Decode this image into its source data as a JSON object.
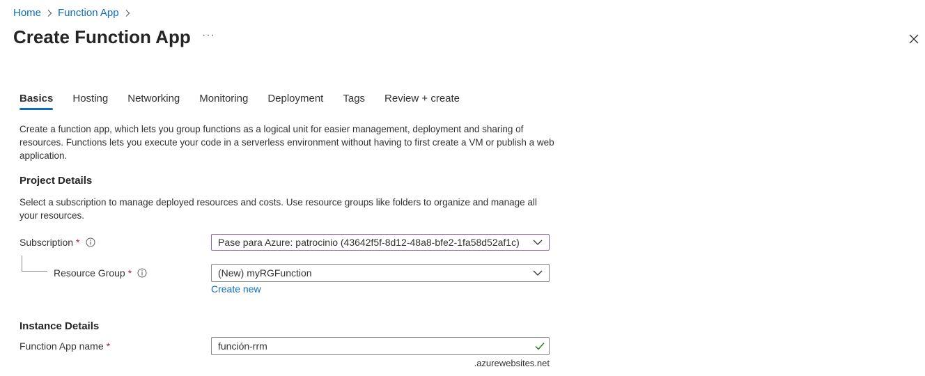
{
  "breadcrumb": {
    "home": "Home",
    "function_app": "Function App"
  },
  "header": {
    "title": "Create Function App",
    "more": "···"
  },
  "tabs": [
    {
      "label": "Basics"
    },
    {
      "label": "Hosting"
    },
    {
      "label": "Networking"
    },
    {
      "label": "Monitoring"
    },
    {
      "label": "Deployment"
    },
    {
      "label": "Tags"
    },
    {
      "label": "Review + create"
    }
  ],
  "intro": "Create a function app, which lets you group functions as a logical unit for easier management, deployment and sharing of resources. Functions lets you execute your code in a serverless environment without having to first create a VM or publish a web application.",
  "project": {
    "heading": "Project Details",
    "desc": "Select a subscription to manage deployed resources and costs. Use resource groups like folders to organize and manage all your resources.",
    "subscription_label": "Subscription",
    "subscription_value": "Pase para Azure: patrocinio (43642f5f-8d12-48a8-bfe2-1fa58d52af1c)",
    "resource_group_label": "Resource Group",
    "resource_group_value": "(New) myRGFunction",
    "create_new": "Create new",
    "required_mark": "*"
  },
  "instance": {
    "heading": "Instance Details",
    "name_label": "Function App name",
    "name_value": "función-rrm",
    "suffix": ".azurewebsites.net"
  },
  "colors": {
    "accent": "#0f6cbd",
    "focus_border": "#8764b8",
    "success": "#107c10",
    "required": "#a4262c"
  },
  "icons": {
    "chevron_right": "chevron-right-icon",
    "close": "close-icon",
    "info": "info-icon",
    "chevron_down": "chevron-down-icon",
    "check": "checkmark-icon"
  }
}
